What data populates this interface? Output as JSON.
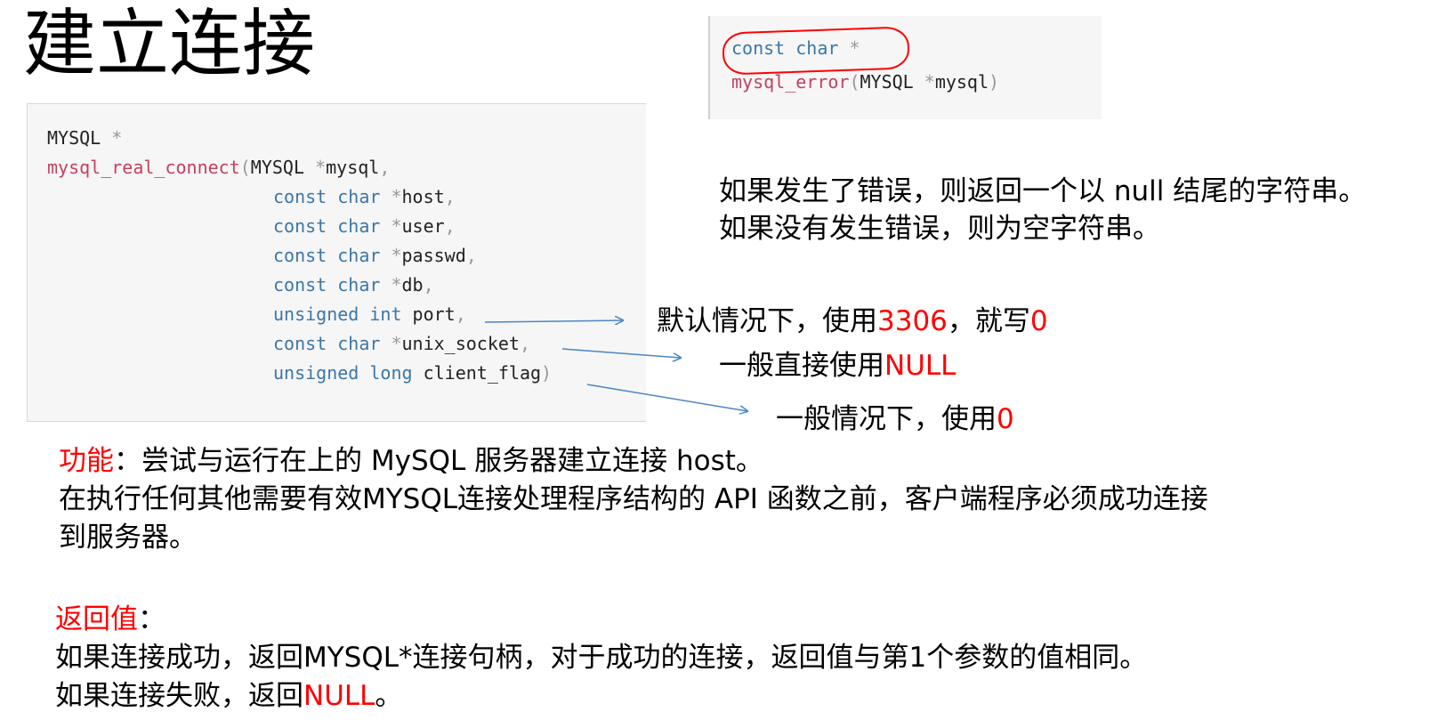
{
  "title": "建立连接",
  "code_connect": {
    "return_type": "MYSQL",
    "return_ptr": " *",
    "fn_name": "mysql_real_connect",
    "open": "(",
    "params": [
      {
        "type": "MYSQL",
        "ptr": " *",
        "name": "mysql",
        "end": ","
      },
      {
        "type": "const char",
        "ptr": " *",
        "name": "host",
        "end": ","
      },
      {
        "type": "const char",
        "ptr": " *",
        "name": "user",
        "end": ","
      },
      {
        "type": "const char",
        "ptr": " *",
        "name": "passwd",
        "end": ","
      },
      {
        "type": "const char",
        "ptr": " *",
        "name": "db",
        "end": ","
      },
      {
        "type": "unsigned int",
        "ptr": " ",
        "name": "port",
        "end": ","
      },
      {
        "type": "const char",
        "ptr": " *",
        "name": "unix_socket",
        "end": ","
      },
      {
        "type": "unsigned long",
        "ptr": " ",
        "name": "client_flag",
        "end": ")"
      }
    ]
  },
  "code_error": {
    "return_type": "const char",
    "return_ptr": " *",
    "fn_name": "mysql_error",
    "open": "(",
    "param_type": "MYSQL",
    "param_ptr": " *",
    "param_name": "mysql",
    "close": ")"
  },
  "error_desc": {
    "line1": "如果发生了错误，则返回一个以 null 结尾的字符串。",
    "line2": "如果没有发生错误，则为空字符串。"
  },
  "notes": {
    "port": {
      "text": "默认情况下，使用",
      "red1": "3306",
      "text2": "，就写",
      "red2": "0"
    },
    "unix_socket": {
      "text": "一般直接使用",
      "red": "NULL"
    },
    "client_flag": {
      "text": "一般情况下，使用",
      "red": "0"
    }
  },
  "function": {
    "label": "功能",
    "colon": "：",
    "line1": "尝试与运行在上的 MySQL 服务器建立连接 host。",
    "line2": "在执行任何其他需要有效MYSQL连接处理程序结构的 API 函数之前，客户端程序必须成功连接",
    "line3": "到服务器。"
  },
  "return_value": {
    "label": "返回值",
    "colon": "：",
    "line1": "如果连接成功，返回MYSQL*连接句柄，对于成功的连接，返回值与第1个参数的值相同。",
    "line2_pre": "如果连接失败，返回",
    "line2_red": "NULL",
    "line2_post": "。"
  },
  "colors": {
    "keyword": "#3b76a8",
    "function": "#c4405f",
    "highlight": "#ff0000",
    "arrow": "#4a86c5"
  }
}
